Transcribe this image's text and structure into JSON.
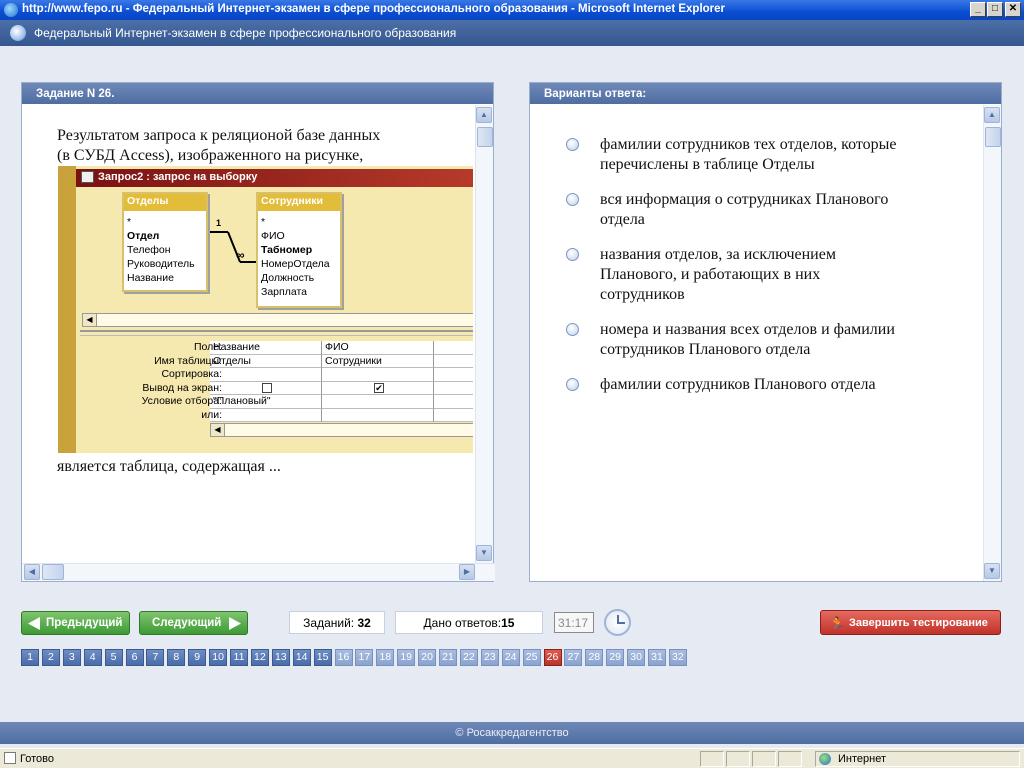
{
  "window": {
    "title": "http://www.fepo.ru - Федеральный Интернет-экзамен в сфере профессионального образования - Microsoft Internet Explorer",
    "minimize": "_",
    "maximize": "□",
    "close": "✕"
  },
  "app": {
    "header": "Федеральный Интернет-экзамен в сфере профессионального образования"
  },
  "question": {
    "title": "Задание N 26.",
    "text_line1": "Результатом запроса к реляционой базе данных",
    "text_line2": "(в СУБД Access), изображенного на рисунке,",
    "text_after": "является таблица, содержащая ..."
  },
  "access_window": {
    "title": "Запрос2 : запрос на выборку",
    "table1": {
      "name": "Отделы",
      "fields": [
        "*",
        "Отдел",
        "Телефон",
        "Руководитель",
        "Название"
      ],
      "bold": [
        1
      ]
    },
    "table2": {
      "name": "Сотрудники",
      "fields": [
        "*",
        "ФИО",
        "Табномер",
        "НомерОтдела",
        "Должность",
        "Зарплата"
      ],
      "bold": [
        2
      ]
    },
    "relation": {
      "one": "1",
      "many": "∞"
    },
    "grid_labels": [
      "Поле:",
      "Имя таблицы:",
      "Сортировка:",
      "Вывод на экран:",
      "Условие отбора:",
      "или:"
    ],
    "col1": {
      "field": "Название",
      "table": "Отделы",
      "show": false,
      "criteria": "\"Плановый\""
    },
    "col2": {
      "field": "ФИО",
      "table": "Сотрудники",
      "show": true,
      "criteria": ""
    }
  },
  "answers": {
    "title": "Варианты ответа:",
    "options": [
      {
        "line1": "фамилии сотрудников тех отделов, которые",
        "line2": "перечислены в таблице Отделы",
        "line3": ""
      },
      {
        "line1": "вся информация о сотрудниках Планового",
        "line2": "отдела",
        "line3": ""
      },
      {
        "line1": "названия отделов, за исключением",
        "line2": "Планового, и работающих в них",
        "line3": "сотрудников"
      },
      {
        "line1": "номера и названия всех отделов и фамилии",
        "line2": "сотрудников Планового отдела",
        "line3": ""
      },
      {
        "line1": "фамилии сотрудников Планового отдела",
        "line2": "",
        "line3": ""
      }
    ]
  },
  "controls": {
    "prev": "Предыдущий",
    "next": "Следующий",
    "tasks_label": "Заданий:",
    "tasks_count": "32",
    "answered_label": "Дано ответов:",
    "answered_count": "15",
    "timer": "31:17",
    "finish": "Завершить тестирование"
  },
  "pager": {
    "pages": [
      "1",
      "2",
      "3",
      "4",
      "5",
      "6",
      "7",
      "8",
      "9",
      "10",
      "11",
      "12",
      "13",
      "14",
      "15",
      "16",
      "17",
      "18",
      "19",
      "20",
      "21",
      "22",
      "23",
      "24",
      "25",
      "26",
      "27",
      "28",
      "29",
      "30",
      "31",
      "32"
    ],
    "current": 26,
    "answered_through": 15
  },
  "footer": "© Росаккредагентство",
  "status": {
    "ready": "Готово",
    "zone": "Интернет"
  }
}
